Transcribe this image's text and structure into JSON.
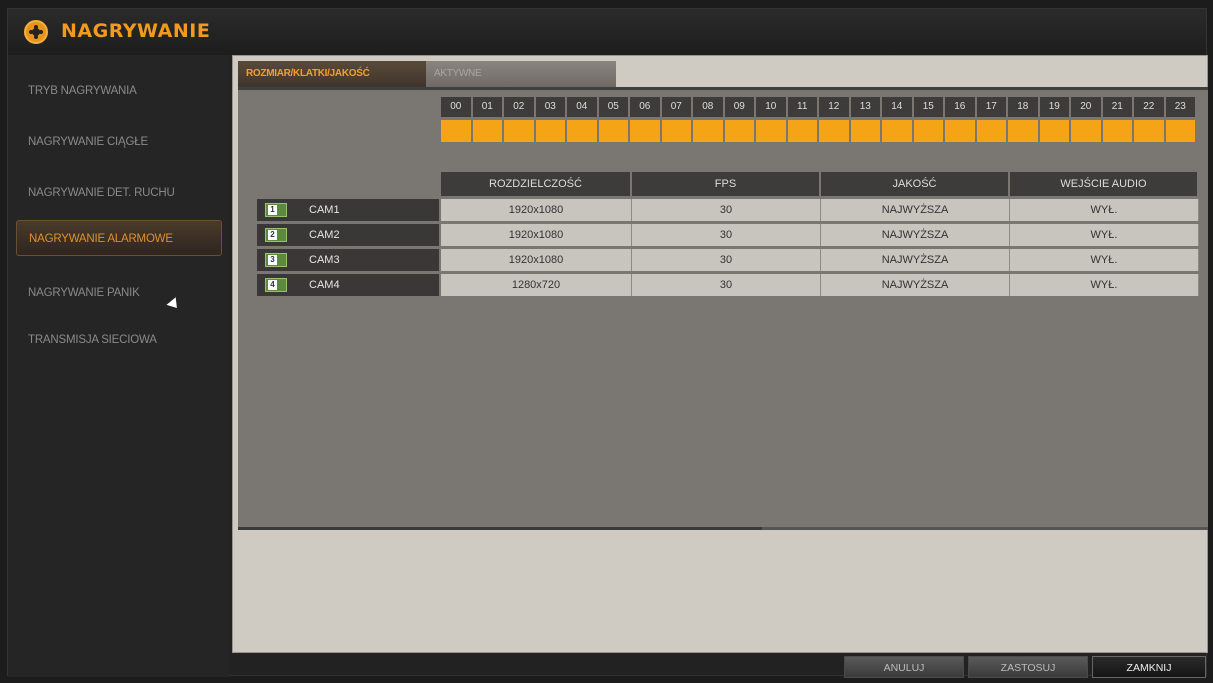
{
  "app": {
    "title": "NAGRYWANIE"
  },
  "sidebar": {
    "items": [
      {
        "label": "TRYB NAGRYWANIA"
      },
      {
        "label": "NAGRYWANIE CIĄGŁE"
      },
      {
        "label": "NAGRYWANIE DET. RUCHU"
      },
      {
        "label": "NAGRYWANIE ALARMOWE",
        "active": true
      },
      {
        "label": "NAGRYWANIE PANIK"
      },
      {
        "label": "TRANSMISJA SIECIOWA"
      }
    ]
  },
  "tabs": [
    {
      "label": "ROZMIAR/KLATKI/JAKOŚĆ",
      "active": true
    },
    {
      "label": "AKTYWNE"
    }
  ],
  "hours": [
    "00",
    "01",
    "02",
    "03",
    "04",
    "05",
    "06",
    "07",
    "08",
    "09",
    "10",
    "11",
    "12",
    "13",
    "14",
    "15",
    "16",
    "17",
    "18",
    "19",
    "20",
    "21",
    "22",
    "23"
  ],
  "table": {
    "columns": [
      "ROZDZIELCZOŚĆ",
      "FPS",
      "JAKOŚĆ",
      "WEJŚCIE AUDIO"
    ],
    "rows": [
      {
        "num": "1",
        "cam": "CAM1",
        "resolution": "1920x1080",
        "fps": "30",
        "quality": "NAJWYŻSZA",
        "audio": "WYŁ."
      },
      {
        "num": "2",
        "cam": "CAM2",
        "resolution": "1920x1080",
        "fps": "30",
        "quality": "NAJWYŻSZA",
        "audio": "WYŁ."
      },
      {
        "num": "3",
        "cam": "CAM3",
        "resolution": "1920x1080",
        "fps": "30",
        "quality": "NAJWYŻSZA",
        "audio": "WYŁ."
      },
      {
        "num": "4",
        "cam": "CAM4",
        "resolution": "1280x720",
        "fps": "30",
        "quality": "NAJWYŻSZA",
        "audio": "WYŁ."
      }
    ]
  },
  "buttons": {
    "cancel": "ANULUJ",
    "apply": "ZASTOSUJ",
    "close": "ZAMKNIJ"
  },
  "colors": {
    "accent": "#f09a1e",
    "schedule_bar": "#f4a416"
  }
}
